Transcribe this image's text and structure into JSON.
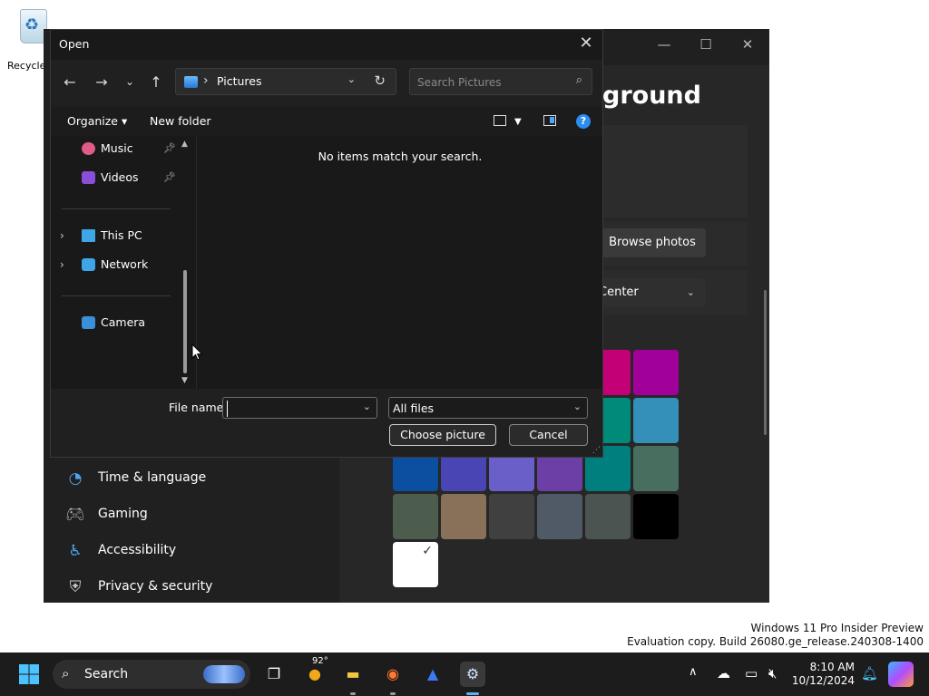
{
  "desktop": {
    "recycle_bin_label": "Recycle",
    "watermark_line1": "Windows 11 Pro Insider Preview",
    "watermark_line2": "Evaluation copy. Build 26080.ge_release.240308-1400"
  },
  "settings": {
    "page_title": "ground",
    "browse_label": "Browse photos",
    "fit_value": "Center",
    "nav_items": [
      {
        "label": "Time & language",
        "icon": "globe-clock-icon"
      },
      {
        "label": "Gaming",
        "icon": "gamepad-icon"
      },
      {
        "label": "Accessibility",
        "icon": "accessibility-icon"
      },
      {
        "label": "Privacy & security",
        "icon": "shield-icon"
      }
    ],
    "swatch_colors": [
      "#c30075",
      "#a2009a",
      "#008a7a",
      "#3490b8",
      "#0b4fa0",
      "#4a45b5",
      "#6a5fc9",
      "#6b3fa5",
      "#007f7f",
      "#486e60",
      "#4c5d4e",
      "#887059",
      "#404040",
      "#4f5a66",
      "#4b5450",
      "#000000",
      "#ffffff"
    ]
  },
  "dialog": {
    "title": "Open",
    "address": "Pictures",
    "search_placeholder": "Search Pictures",
    "organize_label": "Organize",
    "new_folder_label": "New folder",
    "help_glyph": "?",
    "tree": [
      {
        "label": "Music",
        "pinned": true
      },
      {
        "label": "Videos",
        "pinned": true
      },
      {
        "label": "This PC",
        "expandable": true
      },
      {
        "label": "Network",
        "expandable": true
      },
      {
        "label": "Camera"
      }
    ],
    "empty_message": "No items match your search.",
    "filename_label": "File name:",
    "filename_value": "",
    "filter_value": "All files",
    "choose_label": "Choose picture",
    "cancel_label": "Cancel"
  },
  "taskbar": {
    "search_label": "Search",
    "weather_temp": "92°",
    "time": "8:10 AM",
    "date": "10/12/2024"
  }
}
